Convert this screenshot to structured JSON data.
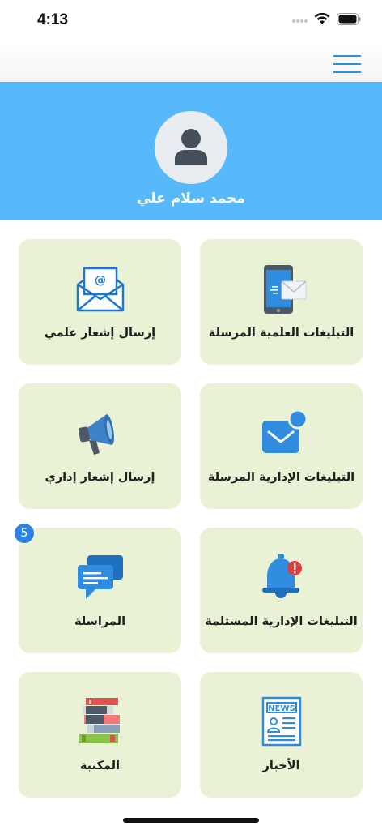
{
  "status_bar": {
    "time": "4:13"
  },
  "profile": {
    "name": "محمد سلام علي"
  },
  "tiles": [
    {
      "label": "التبليغات العلمية المرسلة",
      "icon": "phone-mail-icon"
    },
    {
      "label": "إرسال إشعار علمي",
      "icon": "envelope-at-icon"
    },
    {
      "label": "التبليغات الإدارية المرسلة",
      "icon": "mail-notification-icon"
    },
    {
      "label": "إرسال إشعار إداري",
      "icon": "megaphone-icon"
    },
    {
      "label": "التبليغات الإدارية المستلمة",
      "icon": "bell-alert-icon"
    },
    {
      "label": "المراسلة",
      "icon": "chat-bubbles-icon",
      "badge": "5"
    },
    {
      "label": "الأخبار",
      "icon": "newspaper-icon"
    },
    {
      "label": "المكتبة",
      "icon": "books-icon"
    }
  ],
  "colors": {
    "header": "#58b9fa",
    "tile": "#e9f2d5",
    "accent": "#2d8fd8"
  }
}
